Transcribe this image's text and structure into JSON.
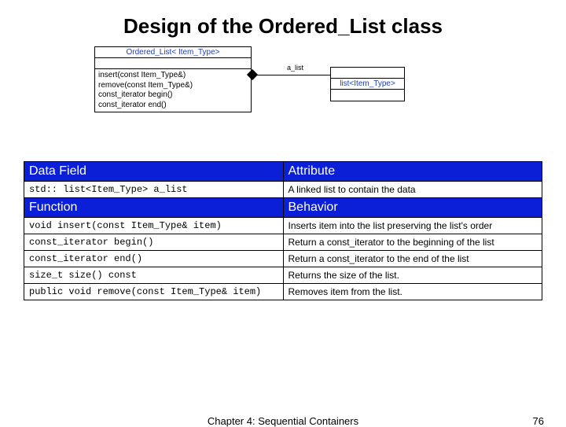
{
  "title": "Design of the Ordered_List class",
  "uml": {
    "left_name": "Ordered_List< Item_Type>",
    "left_ops": "insert(const Item_Type&)\nremove(const Item_Type&)\nconst_iterator begin()\nconst_iterator end()",
    "right_name": "list<Item_Type>",
    "assoc_label": "a_list"
  },
  "table": {
    "hdr_datafield": "Data Field",
    "hdr_attribute": "Attribute",
    "hdr_function": "Function",
    "hdr_behavior": "Behavior",
    "rows_data": [
      {
        "left": "std:: list<Item_Type> a_list",
        "right": "A linked list to contain the data"
      }
    ],
    "rows_func": [
      {
        "left": "void insert(const Item_Type& item)",
        "right": "Inserts item into the list preserving the list's order"
      },
      {
        "left": "const_iterator begin()",
        "right": "Return a const_iterator to the beginning of the list"
      },
      {
        "left": "const_iterator end()",
        "right": "Return a const_iterator to the end of the list"
      },
      {
        "left": "size_t size() const",
        "right": "Returns the size of the list."
      },
      {
        "left": "public void remove(const Item_Type& item)",
        "right": "Removes item from the list."
      }
    ]
  },
  "footer": {
    "center": "Chapter 4: Sequential Containers",
    "page": "76"
  }
}
